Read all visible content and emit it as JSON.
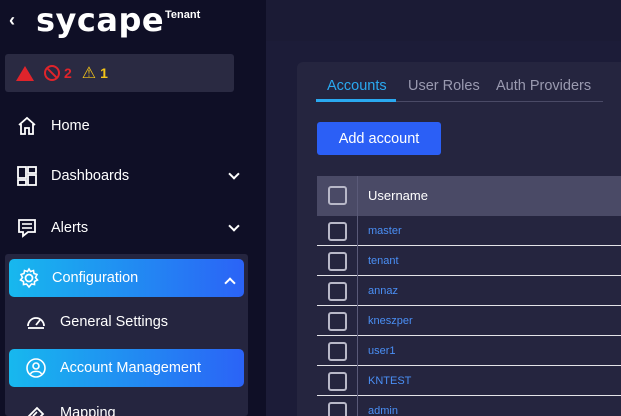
{
  "app": {
    "logo": "sycape",
    "tenant_label": "Tenant"
  },
  "alerts": {
    "critical_count": "2",
    "warning_count": "1"
  },
  "nav": {
    "home": "Home",
    "dashboards": "Dashboards",
    "alerts": "Alerts",
    "configuration": "Configuration",
    "general_settings": "General Settings",
    "account_management": "Account Management",
    "mapping": "Mapping"
  },
  "tabs": [
    "Accounts",
    "User Roles",
    "Auth Providers"
  ],
  "add_button": "Add account",
  "table": {
    "header": "Username",
    "rows": [
      "master",
      "tenant",
      "annaz",
      "kneszper",
      "user1",
      "KNTEST",
      "admin"
    ]
  },
  "colors": {
    "accent_gradient_start": "#17b8ee",
    "accent_gradient_end": "#2b63f6",
    "link": "#4a8ff5",
    "critical": "#e0242b",
    "warning": "#f5c518"
  }
}
